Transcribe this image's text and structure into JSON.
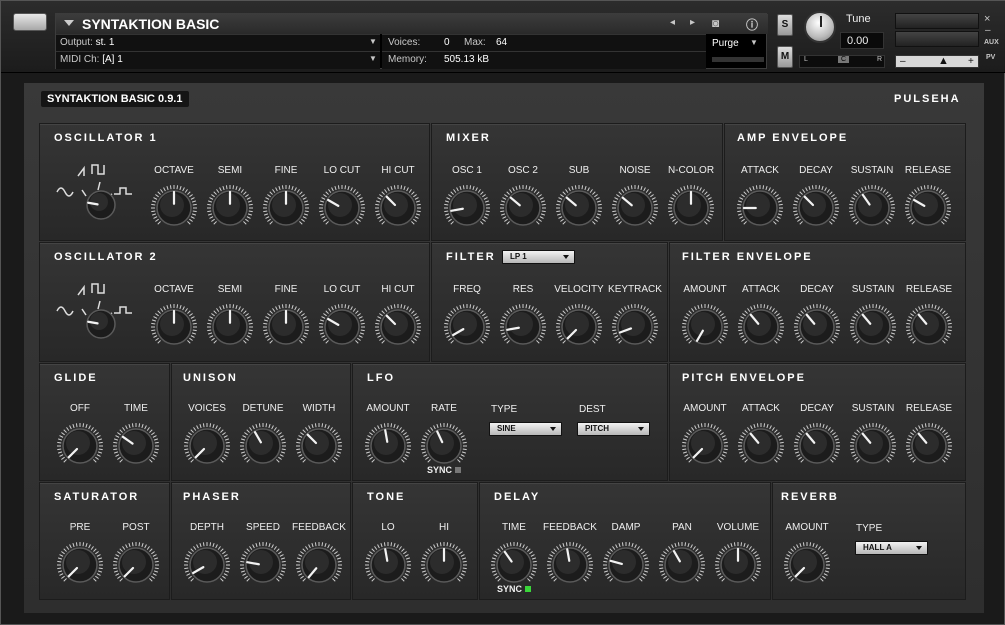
{
  "header": {
    "instrument_name": "SYNTAKTION BASIC",
    "output_label": "Output:",
    "output_value": "st. 1",
    "voices_label": "Voices:",
    "voices_value": "0",
    "max_label": "Max:",
    "max_value": "64",
    "purge_label": "Purge",
    "midi_label": "MIDI Ch:",
    "midi_value": "[A]  1",
    "memory_label": "Memory:",
    "memory_value": "505.13 kB",
    "solo_label": "S",
    "mute_label": "M",
    "tune_label": "Tune",
    "tune_value": "0.00",
    "pan_left": "L",
    "pan_center": "C",
    "pan_right": "R",
    "aux_label": "AUX",
    "pv_label": "PV",
    "vol_minus": "–",
    "vol_plus": "+"
  },
  "version": "SYNTAKTION BASIC 0.9.1",
  "brand": "PULSEHA",
  "sections": {
    "osc1": {
      "title": "OSCILLATOR 1",
      "knobs": [
        "OCTAVE",
        "SEMI",
        "FINE",
        "LO CUT",
        "HI CUT"
      ]
    },
    "mixer": {
      "title": "MIXER",
      "knobs": [
        "OSC 1",
        "OSC 2",
        "SUB",
        "NOISE",
        "N-COLOR"
      ]
    },
    "amp_env": {
      "title": "AMP ENVELOPE",
      "knobs": [
        "ATTACK",
        "DECAY",
        "SUSTAIN",
        "RELEASE"
      ]
    },
    "osc2": {
      "title": "OSCILLATOR 2",
      "knobs": [
        "OCTAVE",
        "SEMI",
        "FINE",
        "LO CUT",
        "HI CUT"
      ]
    },
    "filter": {
      "title": "FILTER",
      "type": "LP 1",
      "knobs": [
        "FREQ",
        "RES",
        "VELOCITY",
        "KEYTRACK"
      ]
    },
    "filter_env": {
      "title": "FILTER ENVELOPE",
      "knobs": [
        "AMOUNT",
        "ATTACK",
        "DECAY",
        "SUSTAIN",
        "RELEASE"
      ]
    },
    "glide": {
      "title": "GLIDE",
      "knobs": [
        "OFF",
        "TIME"
      ]
    },
    "unison": {
      "title": "UNISON",
      "knobs": [
        "VOICES",
        "DETUNE",
        "WIDTH"
      ]
    },
    "lfo": {
      "title": "LFO",
      "knobs": [
        "AMOUNT",
        "RATE"
      ],
      "type_label": "TYPE",
      "type_value": "SINE",
      "dest_label": "DEST",
      "dest_value": "PITCH",
      "sync": "SYNC"
    },
    "pitch_env": {
      "title": "PITCH ENVELOPE",
      "knobs": [
        "AMOUNT",
        "ATTACK",
        "DECAY",
        "SUSTAIN",
        "RELEASE"
      ]
    },
    "saturator": {
      "title": "SATURATOR",
      "knobs": [
        "PRE",
        "POST"
      ]
    },
    "phaser": {
      "title": "PHASER",
      "knobs": [
        "DEPTH",
        "SPEED",
        "FEEDBACK"
      ]
    },
    "tone": {
      "title": "TONE",
      "knobs": [
        "LO",
        "HI"
      ]
    },
    "delay": {
      "title": "DELAY",
      "knobs": [
        "TIME",
        "FEEDBACK",
        "DAMP",
        "PAN",
        "VOLUME"
      ],
      "sync": "SYNC"
    },
    "reverb": {
      "title": "REVERB",
      "knobs": [
        "AMOUNT"
      ],
      "type_label": "TYPE",
      "type_value": "HALL A"
    }
  },
  "knob_angles": {
    "osc1": [
      0,
      0,
      0,
      -60,
      -45
    ],
    "osc2": [
      0,
      0,
      0,
      -60,
      -45
    ],
    "mixer": [
      -100,
      -50,
      -50,
      -50,
      0
    ],
    "amp_env": [
      -90,
      -45,
      -35,
      -60
    ],
    "filter": [
      -120,
      -100,
      -135,
      -110
    ],
    "filter_env": [
      -150,
      -40,
      -40,
      -40,
      -40
    ],
    "glide": [
      -135,
      -55
    ],
    "unison": [
      -135,
      -30,
      -45
    ],
    "lfo": [
      -10,
      -25
    ],
    "pitch_env": [
      -135,
      -40,
      -40,
      -40,
      -40
    ],
    "saturator": [
      -135,
      -135
    ],
    "phaser": [
      -120,
      -80,
      -140
    ],
    "tone": [
      -10,
      0
    ],
    "delay": [
      -35,
      -10,
      -75,
      -30,
      0
    ],
    "reverb": [
      -135
    ],
    "osc1_wave": -80,
    "osc2_wave": -80
  },
  "colors": {
    "sync_delay_led": "#3ad63a",
    "sync_lfo_led": "#777777"
  }
}
